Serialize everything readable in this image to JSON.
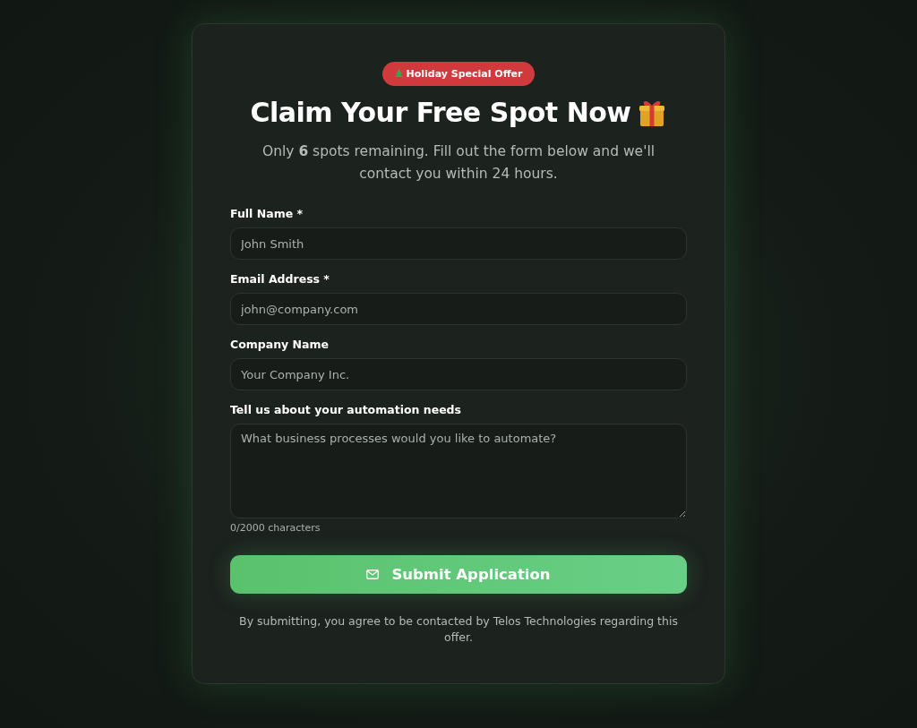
{
  "badge": {
    "label": "Holiday Special Offer"
  },
  "title": "Claim Your Free Spot Now",
  "subtitle": "Only **6** spots remaining. Fill out the form below and we'll contact you within 24 hours.",
  "fields": [
    {
      "label": "Full Name *",
      "placeholder": "John Smith",
      "kind": "input"
    },
    {
      "label": "Email Address *",
      "placeholder": "john@company.com",
      "kind": "input"
    },
    {
      "label": "Company Name",
      "placeholder": "Your Company Inc.",
      "kind": "input"
    },
    {
      "label": "Tell us about your automation needs",
      "placeholder": "What business processes would you like to automate?",
      "kind": "textarea",
      "counter": "0/2000 characters"
    }
  ],
  "submit": {
    "label": "Submit Application"
  },
  "disclaimer": "By submitting, you agree to be contacted by Telos Technologies regarding this offer."
}
